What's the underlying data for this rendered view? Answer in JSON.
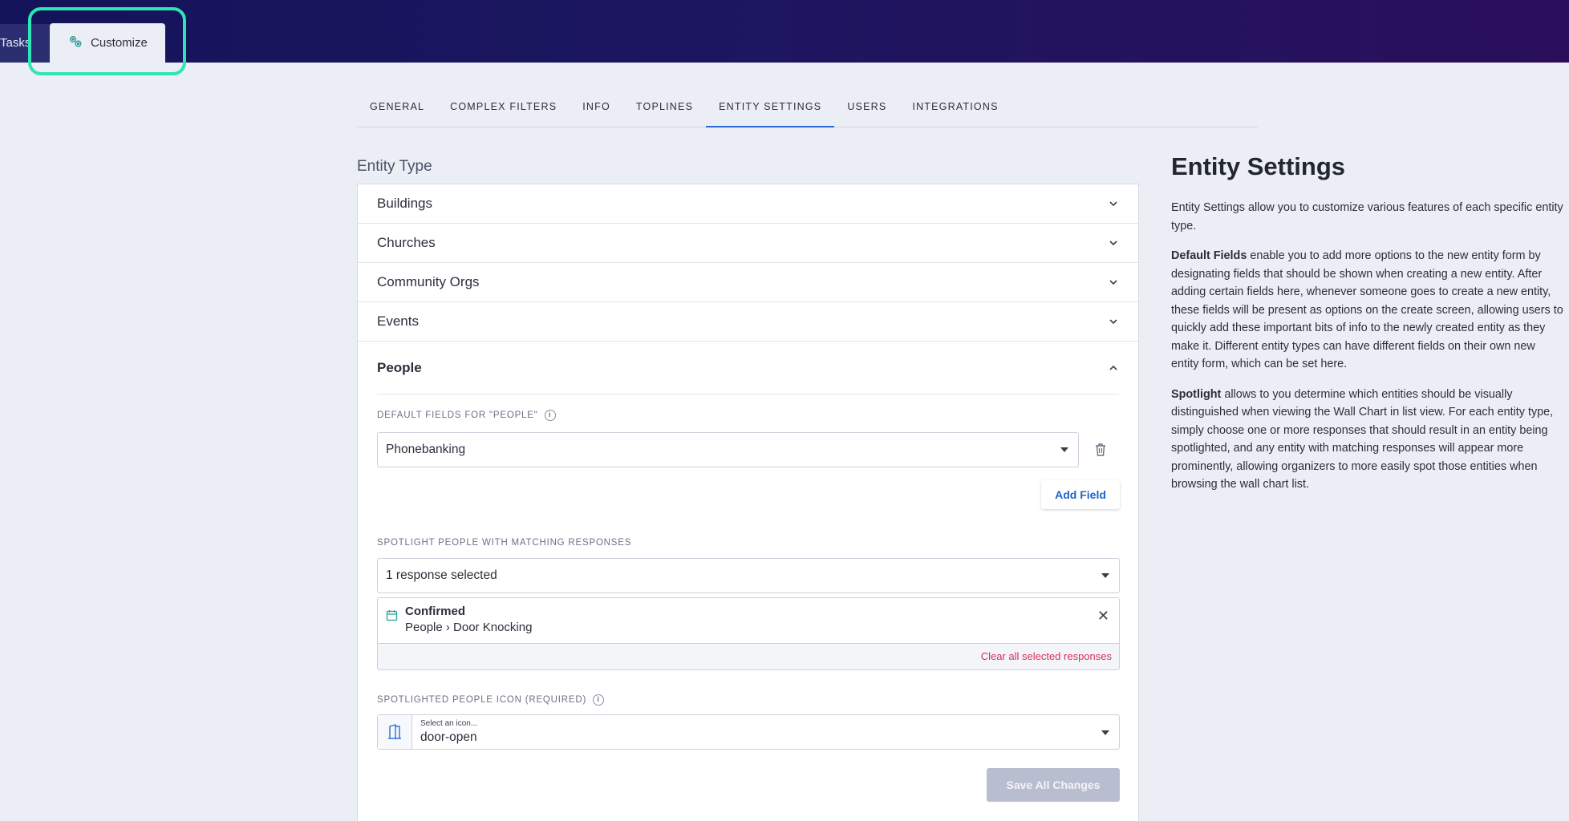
{
  "topbar": {
    "tabs": [
      {
        "label": "Tasks",
        "active": false
      },
      {
        "label": "Customize",
        "active": true
      }
    ]
  },
  "subnav": {
    "tabs": [
      {
        "label": "GENERAL",
        "active": false
      },
      {
        "label": "COMPLEX FILTERS",
        "active": false
      },
      {
        "label": "INFO",
        "active": false
      },
      {
        "label": "TOPLINES",
        "active": false
      },
      {
        "label": "ENTITY SETTINGS",
        "active": true
      },
      {
        "label": "USERS",
        "active": false
      },
      {
        "label": "INTEGRATIONS",
        "active": false
      }
    ]
  },
  "entity_type": {
    "title": "Entity Type",
    "collapsed": [
      "Buildings",
      "Churches",
      "Community Orgs",
      "Events"
    ],
    "expanded": {
      "name": "People",
      "default_fields_label": "DEFAULT FIELDS FOR \"PEOPLE\"",
      "default_field_value": "Phonebanking",
      "add_field_label": "Add Field",
      "spotlight_label": "SPOTLIGHT PEOPLE WITH MATCHING RESPONSES",
      "spotlight_select_value": "1 response selected",
      "selected_response": {
        "title": "Confirmed",
        "path": "People › Door Knocking"
      },
      "clear_label": "Clear all selected responses",
      "icon_label": "SPOTLIGHTED PEOPLE ICON (REQUIRED)",
      "icon_placeholder": "Select an icon...",
      "icon_value": "door-open",
      "save_label": "Save All Changes"
    }
  },
  "help": {
    "title": "Entity Settings",
    "intro": "Entity Settings allow you to customize various features of each specific entity type.",
    "default_fields_term": "Default Fields",
    "default_fields_text": " enable you to add more options to the new entity form by designating fields that should be shown when creating a new entity. After adding certain fields here, whenever someone goes to create a new entity, these fields will be present as options on the create screen, allowing users to quickly add these important bits of info to the newly created entity as they make it. Different entity types can have different fields on their own new entity form, which can be set here.",
    "spotlight_term": "Spotlight",
    "spotlight_text": " allows to you determine which entities should be visually distinguished when viewing the Wall Chart in list view. For each entity type, simply choose one or more responses that should result in an entity being spotlighted, and any entity with matching responses will appear more prominently, allowing organizers to more easily spot those entities when browsing the wall chart list."
  },
  "colors": {
    "accent": "#2c6bd6",
    "highlight_ring": "#2ee6b5",
    "clear_link": "#d6305c",
    "save_disabled": "#b9bdd0"
  }
}
